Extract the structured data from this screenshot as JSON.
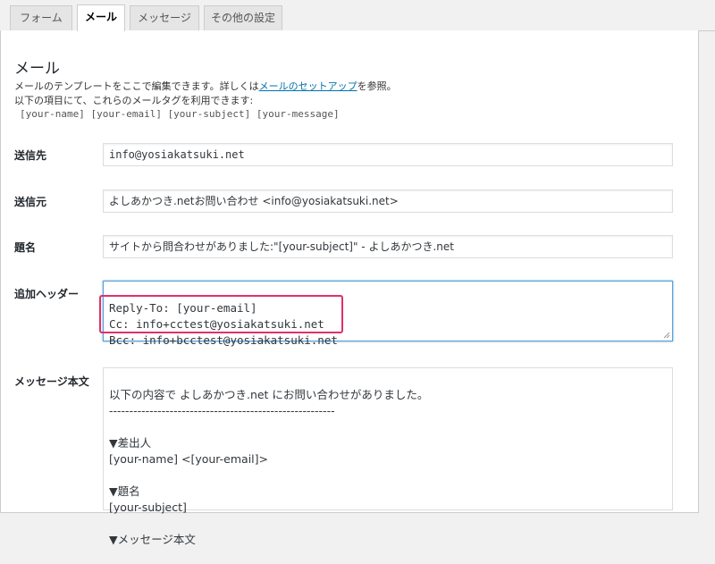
{
  "tabs": [
    {
      "label": "フォーム"
    },
    {
      "label": "メール"
    },
    {
      "label": "メッセージ"
    },
    {
      "label": "その他の設定"
    }
  ],
  "section": {
    "title": "メール",
    "desc1_before": "メールのテンプレートをここで編集できます。詳しくは",
    "desc1_link": "メールのセットアップ",
    "desc1_after": "を参照。",
    "desc2": "以下の項目にて、これらのメールタグを利用できます:",
    "tags": "[your-name] [your-email] [your-subject] [your-message]"
  },
  "fields": {
    "to": {
      "label": "送信先",
      "value": "info@yosiakatsuki.net"
    },
    "from": {
      "label": "送信元",
      "value": "よしあかつき.netお問い合わせ <info@yosiakatsuki.net>"
    },
    "subject": {
      "label": "題名",
      "value": "サイトから問合わせがありました:\"[your-subject]\" - よしあかつき.net"
    },
    "headers": {
      "label": "追加ヘッダー",
      "line1": "Reply-To: [your-email]",
      "line2": "Cc: info+cctest@yosiakatsuki.net",
      "line3": "Bcc: info+bcctest@yosiakatsuki.net"
    },
    "body": {
      "label": "メッセージ本文",
      "line1": "以下の内容で よしあかつき.net にお問い合わせがありました。",
      "line2": "--------------------------------------------------------",
      "line3": "",
      "line4": "▼差出人",
      "line5": "[your-name] <[your-email]>",
      "line6": "",
      "line7": "▼題名",
      "line8": "[your-subject]",
      "line9": "",
      "line10": "▼メッセージ本文"
    }
  },
  "colors": {
    "highlight": "#e0306a",
    "link": "#0073aa",
    "focus": "#5b9dd9"
  }
}
